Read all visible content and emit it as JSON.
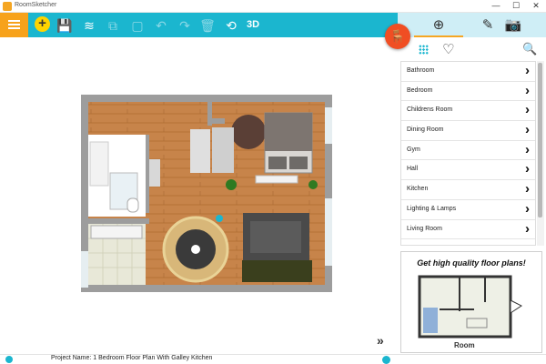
{
  "window": {
    "title": "RoomSketcher",
    "controls": [
      "—",
      "☐",
      "✕"
    ]
  },
  "toolbar": {
    "icons": [
      "menu-icon",
      "add-icon",
      "save-icon",
      "walls-icon",
      "copy-icon",
      "paste-icon",
      "undo-icon",
      "redo-icon",
      "delete-icon",
      "rotate-icon",
      "3d-view"
    ],
    "label_3d": "3D",
    "icon_glyphs": {
      "save": "💾",
      "walls": "≋",
      "copy": "⧉",
      "paste": "▢",
      "undo": "↶",
      "redo": "↷",
      "delete": "🗑",
      "rotate": "⟲"
    }
  },
  "right_panel": {
    "tabs": [
      {
        "name": "add",
        "glyph": "⊕"
      },
      {
        "name": "edit",
        "glyph": "✎"
      },
      {
        "name": "camera",
        "glyph": "📷"
      }
    ],
    "categories": [
      {
        "label": "Bathroom"
      },
      {
        "label": "Bedroom"
      },
      {
        "label": "Childrens Room"
      },
      {
        "label": "Dining Room"
      },
      {
        "label": "Gym"
      },
      {
        "label": "Hall"
      },
      {
        "label": "Kitchen"
      },
      {
        "label": "Lighting & Lamps"
      },
      {
        "label": "Living Room"
      }
    ],
    "ad": {
      "headline": "Get high quality floor plans!",
      "brand": "Room"
    }
  },
  "status": {
    "project_name": "Project Name: 1 Bedroom Floor Plan With Galley Kitchen"
  },
  "colors": {
    "accent": "#1bb6cf",
    "orange": "#f7a21b",
    "furniture": "#f04e23"
  }
}
